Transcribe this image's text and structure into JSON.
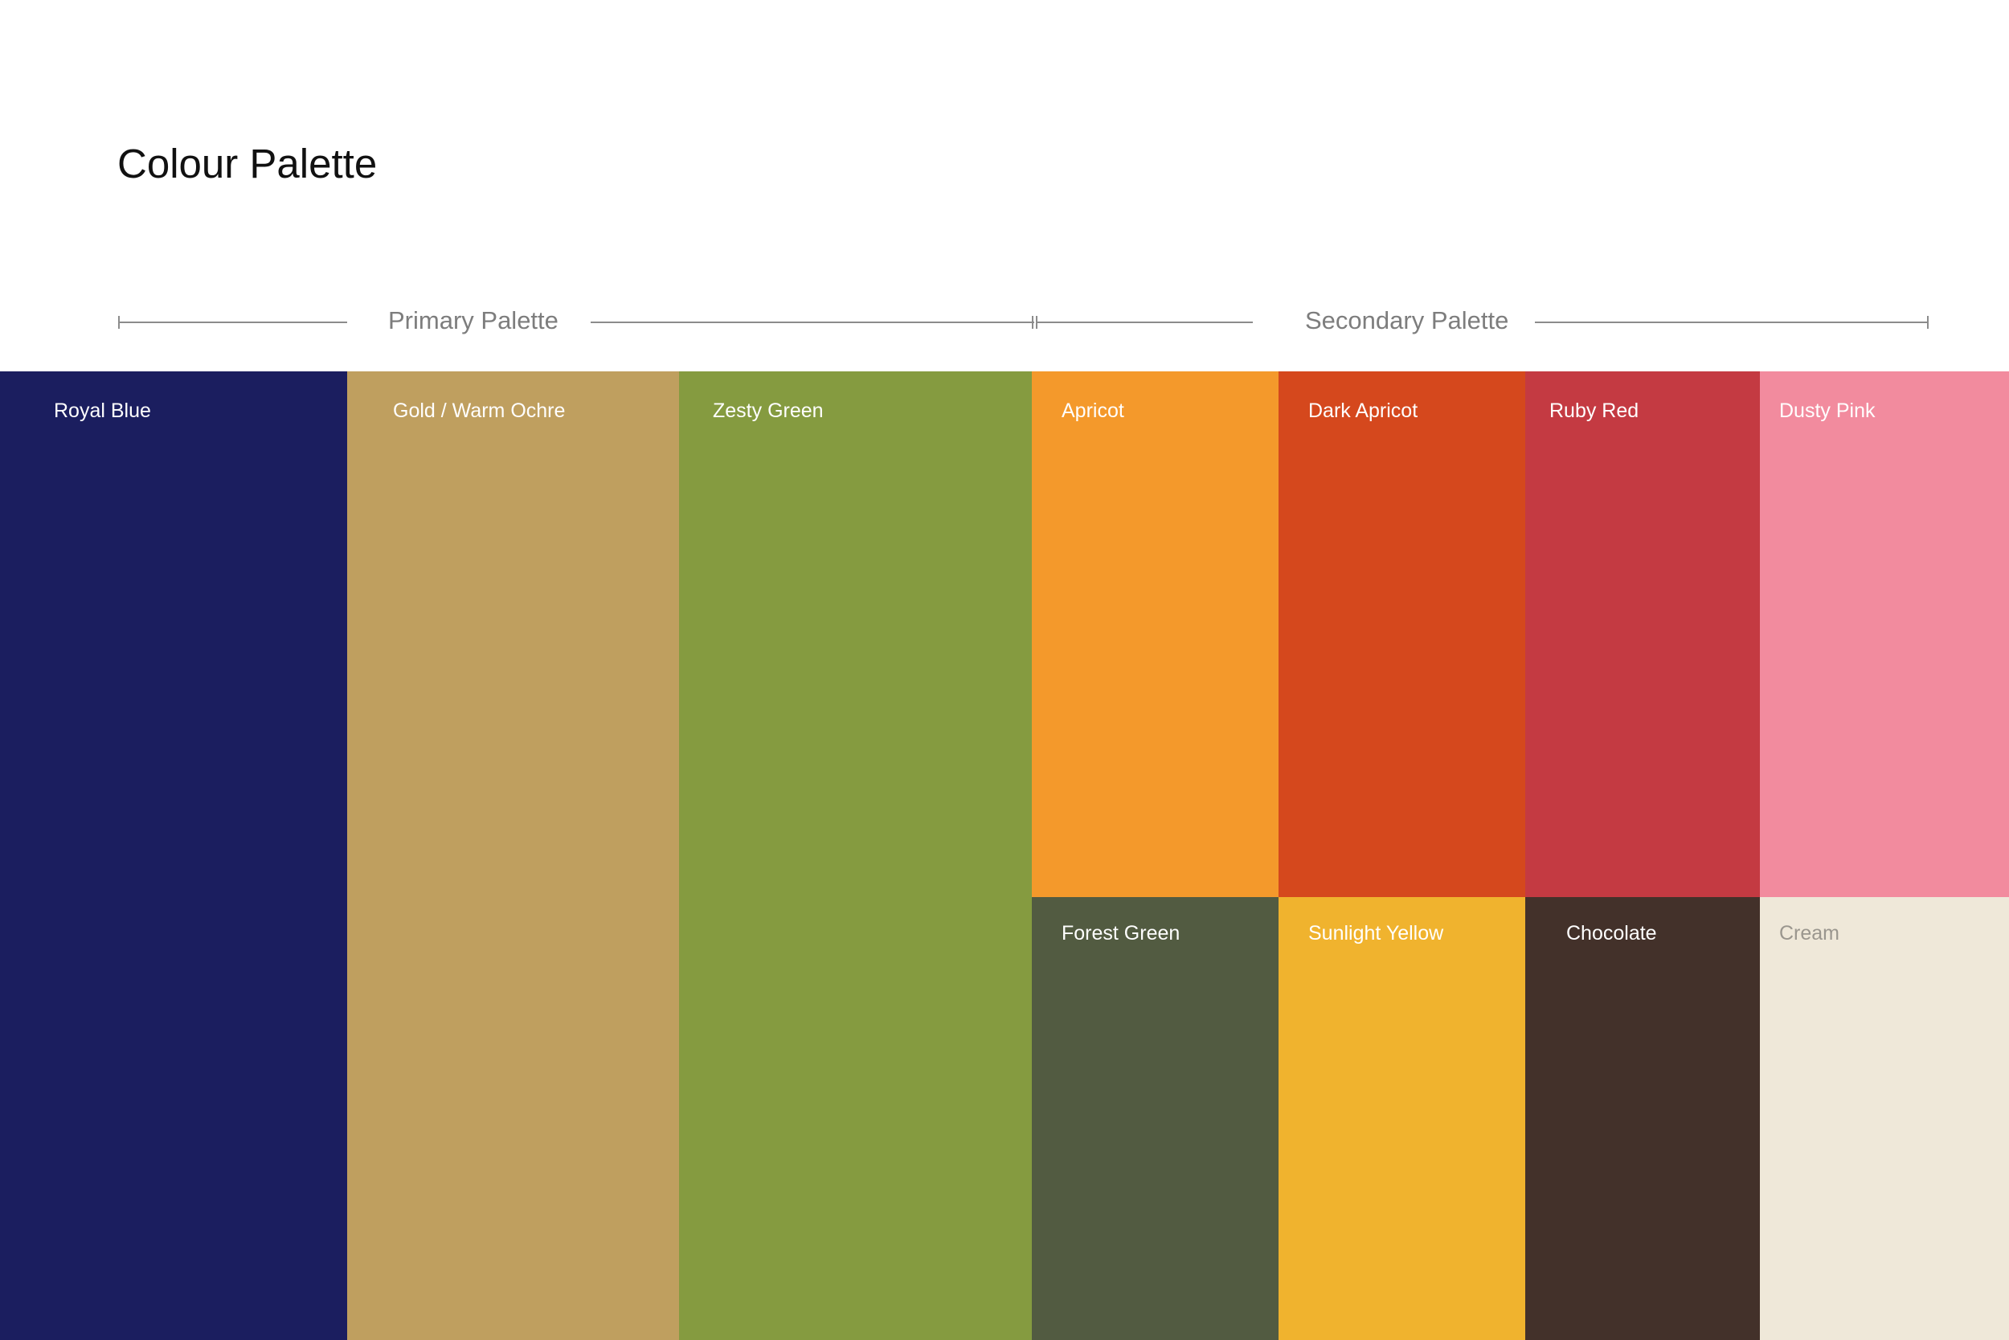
{
  "title": "Colour Palette",
  "groups": {
    "primary_label": "Primary Palette",
    "secondary_label": "Secondary Palette"
  },
  "swatches": {
    "royal_blue": {
      "name": "Royal Blue",
      "color": "#1b1e5f",
      "text_color": "#ffffff"
    },
    "gold_warm_ochre": {
      "name": "Gold / Warm Ochre",
      "color": "#bf9f5f",
      "text_color": "#ffffff"
    },
    "zesty_green": {
      "name": "Zesty Green",
      "color": "#859b40",
      "text_color": "#ffffff"
    },
    "apricot": {
      "name": "Apricot",
      "color": "#f4992b",
      "text_color": "#ffffff"
    },
    "dark_apricot": {
      "name": "Dark Apricot",
      "color": "#d5481d",
      "text_color": "#ffffff"
    },
    "ruby_red": {
      "name": "Ruby Red",
      "color": "#c43a42",
      "text_color": "#ffffff"
    },
    "dusty_pink": {
      "name": "Dusty Pink",
      "color": "#f28b9e",
      "text_color": "#ffffff"
    },
    "forest_green": {
      "name": "Forest Green",
      "color": "#525b41",
      "text_color": "#ffffff"
    },
    "sunlight_yellow": {
      "name": "Sunlight Yellow",
      "color": "#f0b32e",
      "text_color": "#ffffff"
    },
    "chocolate": {
      "name": "Chocolate",
      "color": "#43312a",
      "text_color": "#ffffff"
    },
    "cream": {
      "name": "Cream",
      "color": "#efe8d9",
      "text_color": "#9a968e"
    }
  }
}
